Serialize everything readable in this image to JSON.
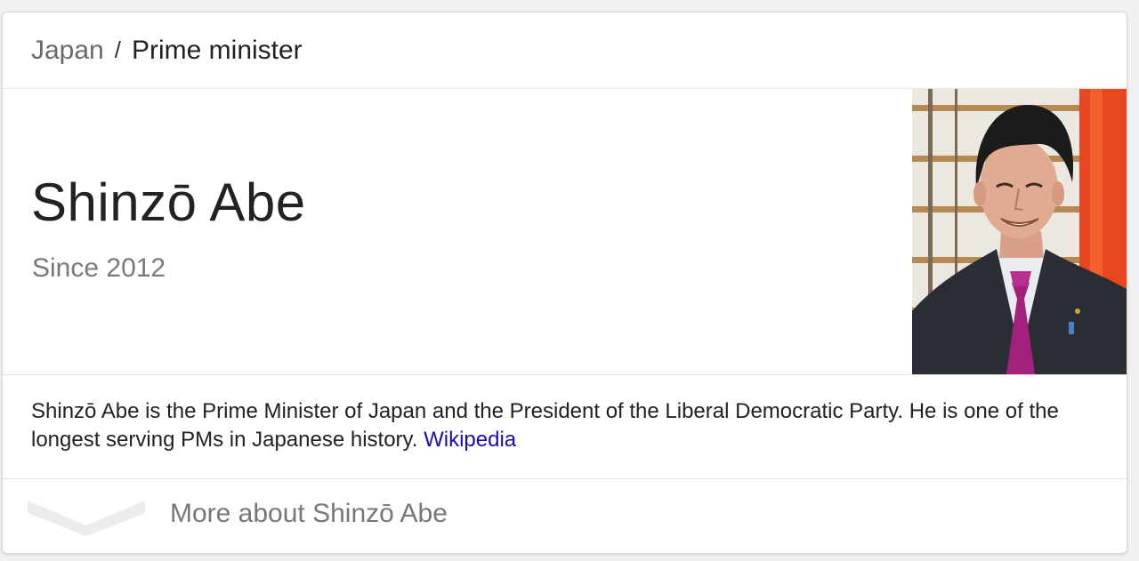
{
  "breadcrumb": {
    "parent": "Japan",
    "separator": "/",
    "current": "Prime minister"
  },
  "entity": {
    "name": "Shinzō Abe",
    "subtitle": "Since 2012",
    "photo_icon": "person-photo"
  },
  "description": {
    "text": "Shinzō Abe is the Prime Minister of Japan and the President of the Liberal Democratic Party. He is one of the longest serving PMs in Japanese history. ",
    "source_link": "Wikipedia"
  },
  "more": {
    "label": "More about Shinzō Abe",
    "icon": "chevron-down-icon"
  },
  "colors": {
    "link": "#1a0dab",
    "primary_text": "#222222",
    "secondary_text": "#777777",
    "divider": "#e3e3e3"
  }
}
